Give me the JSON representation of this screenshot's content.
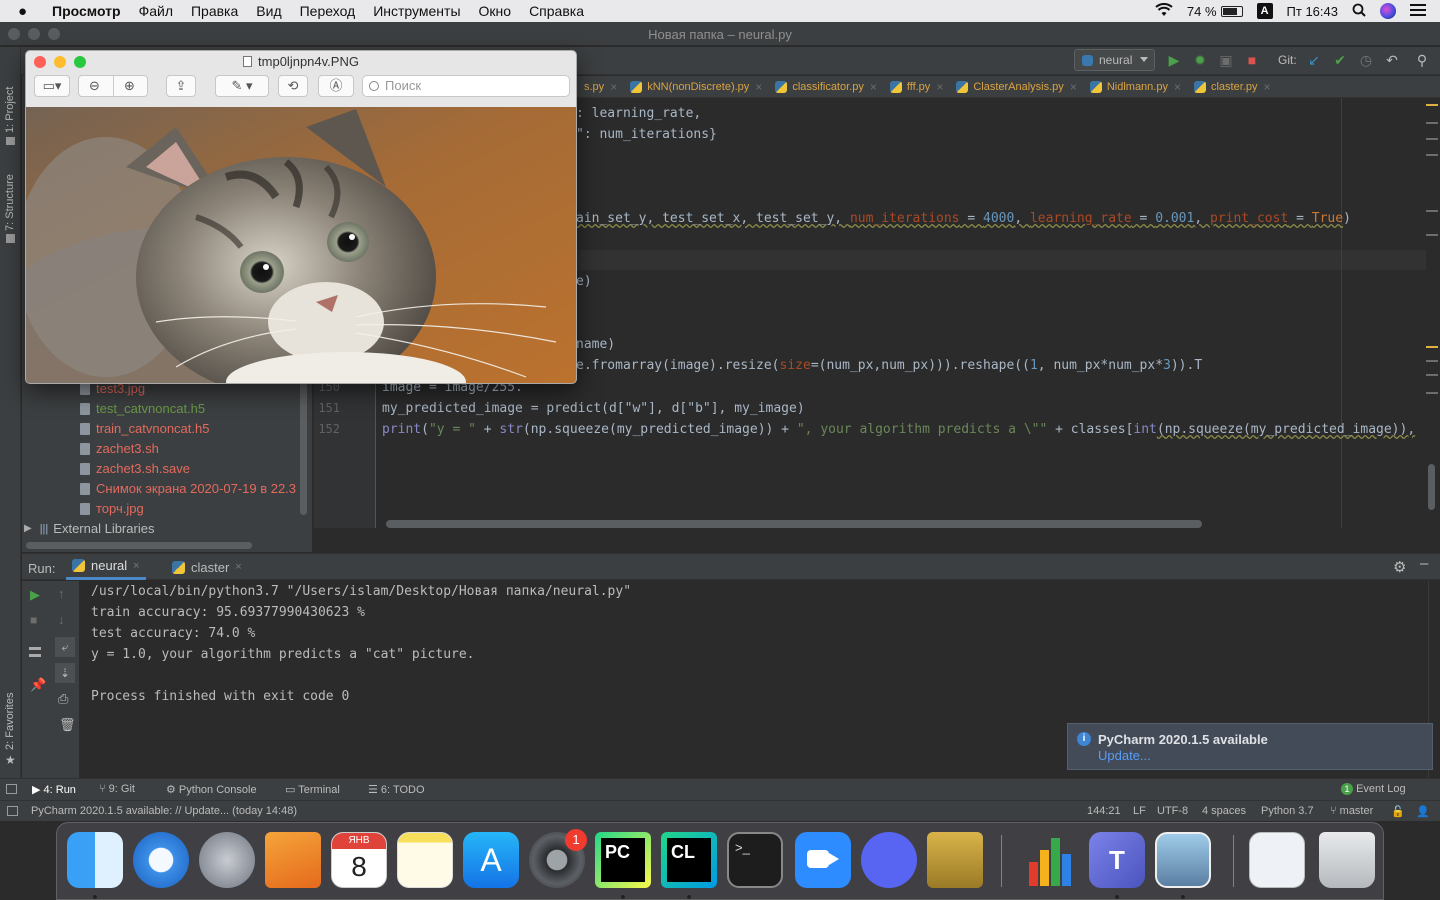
{
  "menubar": {
    "app": "Просмотр",
    "items": [
      "Файл",
      "Правка",
      "Вид",
      "Переход",
      "Инструменты",
      "Окно",
      "Справка"
    ],
    "battery": "74 %",
    "input_source": "A",
    "clock": "Пт 16:43"
  },
  "pycharm": {
    "window_title": "Новая папка – neural.py",
    "run_config": "neural",
    "git_label": "Git:",
    "tabs": [
      {
        "label": "s.py"
      },
      {
        "label": "kNN(nonDiscrete).py"
      },
      {
        "label": "classificator.py"
      },
      {
        "label": "fff.py"
      },
      {
        "label": "ClasterAnalysis.py"
      },
      {
        "label": "Nidlmann.py"
      },
      {
        "label": "claster.py"
      }
    ],
    "side_labels": {
      "project": "1: Project",
      "structure": "7: Structure",
      "favorites": "2: Favorites"
    },
    "project_files": [
      "test3.jpg",
      "test_catvnoncat.h5",
      "train_catvnoncat.h5",
      "zachet3.sh",
      "zachet3.sh.save",
      "Снимок экрана 2020-07-19 в 22.3",
      "торч.jpg"
    ],
    "external_libraries": "External Libraries",
    "code": {
      "line1": ": learning_rate,",
      "line2": "\": num_iterations}",
      "line3_a": "ain_set_y, test_set_x, test_set_y, ",
      "line3_b": "num_iterations",
      "line3_c": " = ",
      "line3_d": "4000",
      "line3_e": ", ",
      "line3_f": "learning_rate",
      "line3_g": " = ",
      "line3_h": "0.001",
      "line3_i": ", ",
      "line3_j": "print_cost",
      "line3_k": " = ",
      "line3_l": "True",
      "line3_m": ")",
      "line4": "e)",
      "line5": "name)",
      "line6_a": "e.fromarray(image).resize(",
      "line6_b": "size",
      "line6_c": "=(num_px,num_px))).reshape((",
      "line6_d": "1",
      "line6_e": ", num_px*num_px*",
      "line6_f": "3",
      "line6_g": ")).T",
      "ln150": "150",
      "line150": "image = image/255.",
      "ln151": "151",
      "line151": "my_predicted_image = predict(d[\"w\"], d[\"b\"], my_image)",
      "ln152": "152",
      "line152_a": "print",
      "line152_b": "(",
      "line152_c": "\"y = \"",
      "line152_d": " + ",
      "line152_e": "str",
      "line152_f": "(np.squeeze(my_predicted_image)) + ",
      "line152_g": "\", your algorithm predicts a \\\"\"",
      "line152_h": " + classes[",
      "line152_i": "int",
      "line152_j": "(np.squeeze(my_predicted_image)),"
    },
    "run": {
      "label": "Run:",
      "tabs": [
        "neural",
        "claster"
      ],
      "output": [
        "/usr/local/bin/python3.7 \"/Users/islam/Desktop/Новая папка/neural.py\"",
        "train accuracy: 95.69377990430623 %",
        "test accuracy: 74.0 %",
        "y = 1.0, your algorithm predicts a \"cat\" picture.",
        "",
        "Process finished with exit code 0"
      ]
    },
    "notification": {
      "title": "PyCharm 2020.1.5 available",
      "link": "Update..."
    },
    "tool_windows": [
      "4: Run",
      "9: Git",
      "Python Console",
      "Terminal",
      "6: TODO"
    ],
    "event_log": "Event Log",
    "event_count": "1",
    "status": {
      "message": "PyCharm 2020.1.5 available: // Update... (today 14:48)",
      "position": "144:21",
      "line_sep": "LF",
      "encoding": "UTF-8",
      "indent": "4 spaces",
      "interpreter": "Python 3.7",
      "branch": "master"
    }
  },
  "preview": {
    "title": "tmp0ljnpn4v.PNG",
    "search_placeholder": "Поиск"
  },
  "dock": {
    "calendar_month": "ЯНВ",
    "calendar_day": "8",
    "settings_badge": "1",
    "apps": [
      "finder-icon",
      "safari-icon",
      "launchpad-icon",
      "pages-icon",
      "calendar-icon",
      "notes-icon",
      "app-store-icon",
      "system-preferences-icon",
      "pycharm-icon",
      "clion-icon",
      "terminal-icon",
      "zoom-icon",
      "discord-icon",
      "archive-utility-icon",
      "numbers-icon",
      "teams-icon",
      "preview-icon",
      "documents-icon",
      "trash-icon"
    ]
  }
}
